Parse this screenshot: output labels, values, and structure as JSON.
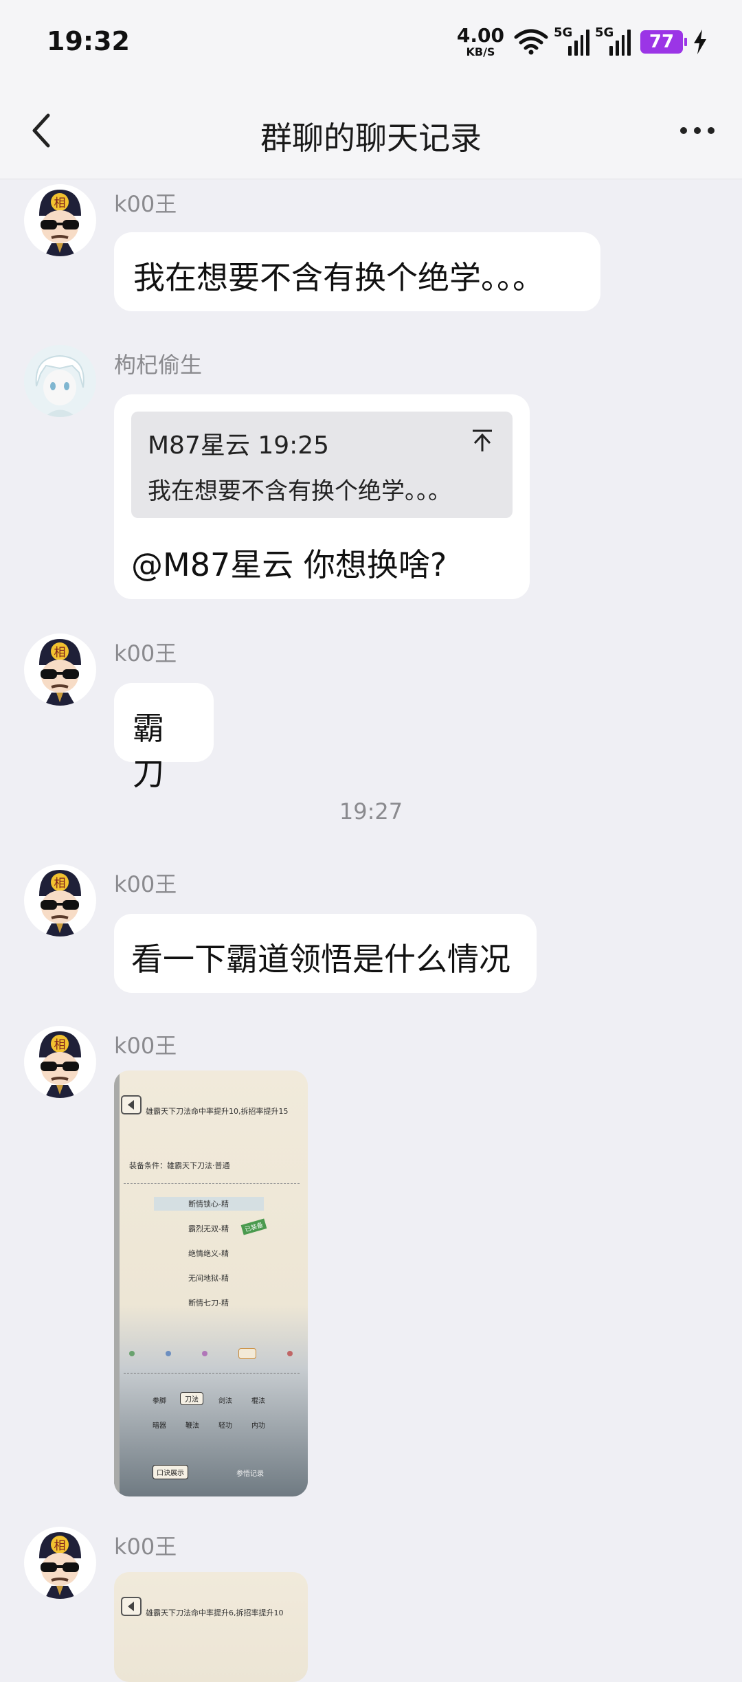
{
  "status": {
    "time": "19:32",
    "net_speed": "4.00",
    "net_unit": "KB/S",
    "sim1": "5G",
    "sim2": "5G",
    "battery": "77"
  },
  "header": {
    "title": "群聊的聊天记录"
  },
  "messages": [
    {
      "sender": "k00王",
      "text": "我在想要不含有换个绝学。。。"
    },
    {
      "sender": "枸杞偷生",
      "quote_head": "M87星云 19:25",
      "quote_text": "我在想要不含有换个绝学。。。",
      "text": "@M87星云 你想换啥?"
    },
    {
      "sender": "k00王",
      "text": "霸刀"
    },
    {
      "sender": "k00王",
      "text": "看一下霸道领悟是什么情况"
    },
    {
      "sender": "k00王"
    },
    {
      "sender": "k00王"
    }
  ],
  "timestamp": "19:27",
  "image1": {
    "title": "雄霸天下刀法命中率提升10,拆招率提升15",
    "condition": "装备条件：雄霸天下刀法·普通",
    "items": [
      "断情锁心-精",
      "霸烈无双-精",
      "绝情绝义-精",
      "无间地狱-精",
      "断情七刀-精"
    ],
    "badge": "已装备",
    "tabs": [
      "拳脚",
      "刀法",
      "剑法",
      "棍法",
      "暗器",
      "鞭法",
      "轻功",
      "内功"
    ],
    "btn_left": "口诀展示",
    "btn_right": "参悟记录"
  },
  "image2": {
    "title": "雄霸天下刀法命中率提升6,拆招率提升10"
  }
}
